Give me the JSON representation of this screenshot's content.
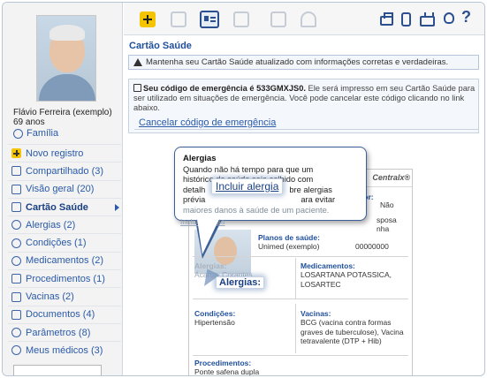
{
  "user": {
    "name": "Flávio Ferreira (exemplo)",
    "age": "69 anos",
    "family_link": "Família"
  },
  "sidebar": {
    "items": [
      {
        "label": "Novo registro",
        "icon": "plus-icon"
      },
      {
        "label": "Compartilhado (3)",
        "icon": "share-icon"
      },
      {
        "label": "Visão geral (20)",
        "icon": "overview-icon"
      },
      {
        "label": "Cartão Saúde",
        "icon": "card-icon",
        "active": true
      },
      {
        "label": "Alergias (2)",
        "icon": "allergy-icon"
      },
      {
        "label": "Condições (1)",
        "icon": "stethoscope-icon"
      },
      {
        "label": "Medicamentos (2)",
        "icon": "pill-icon"
      },
      {
        "label": "Procedimentos (1)",
        "icon": "syringe-icon"
      },
      {
        "label": "Vacinas (2)",
        "icon": "vaccine-icon"
      },
      {
        "label": "Documentos (4)",
        "icon": "document-icon"
      },
      {
        "label": "Parâmetros (8)",
        "icon": "parameters-icon"
      },
      {
        "label": "Meus médicos (3)",
        "icon": "doctor-icon"
      }
    ]
  },
  "toolbar": {
    "left_icons": [
      "add-icon",
      "folder-icon",
      "health-card-icon",
      "chart-icon",
      "graph-icon",
      "person-icon"
    ],
    "right_icons": [
      "printer-icon",
      "phone-icon",
      "tv-icon",
      "lightbulb-icon",
      "help-icon"
    ],
    "help_glyph": "?"
  },
  "main": {
    "title": "Cartão Saúde",
    "info_message": "Mantenha seu Cartão Saúde atualizado com informações corretas e verdadeiras.",
    "emergency": {
      "code_text": "Seu código de emergência é 533GMXJS0.",
      "rest_text": " Ele será impresso em seu Cartão Saúde para ser utilizado em situações de emergência. Você pode cancelar este código clicando no link abaixo.",
      "cancel_link": "Cancelar código de emergência"
    }
  },
  "card": {
    "brand": "Centralx®",
    "organ_donor_label": "Doador:",
    "organ_donor_value": "Não",
    "partial_line_1": "sposa",
    "partial_line_2": "nha",
    "health_plans_label": "Planos de saúde:",
    "health_plan_value": "Unimed (exemplo)",
    "health_plan_number": "00000000",
    "allergies_label": "Alergias:",
    "allergies_value": "Ácaros, Corantes",
    "medications_label": "Medicamentos:",
    "medications_value": "LOSARTANA POTASSICA, LOSARTEC",
    "conditions_label": "Condições:",
    "conditions_value": "Hipertensão",
    "vaccines_label": "Vacinas:",
    "vaccines_value": "BCG (vacina contra formas graves de tuberculose), Vacina tetravalente (DTP + Hib)",
    "procedures_label": "Procedimentos:",
    "procedures_value": "Ponte safena dupla"
  },
  "tooltip": {
    "title": "Alergias",
    "body_line_1": "Quando não há tempo para que um",
    "body_line_2": "histórico de saúde seja colhido com",
    "body_line_3": "detalh",
    "body_line_3_end": "bre alergias",
    "body_line_4": "prévia",
    "body_line_4_end": "ara evitar",
    "body_line_5": "maiores danos à saúde de um paciente.",
    "faded_link": "Incluir alergia",
    "callout_link": "Incluir alergia"
  },
  "field_callout": "Alergias:"
}
